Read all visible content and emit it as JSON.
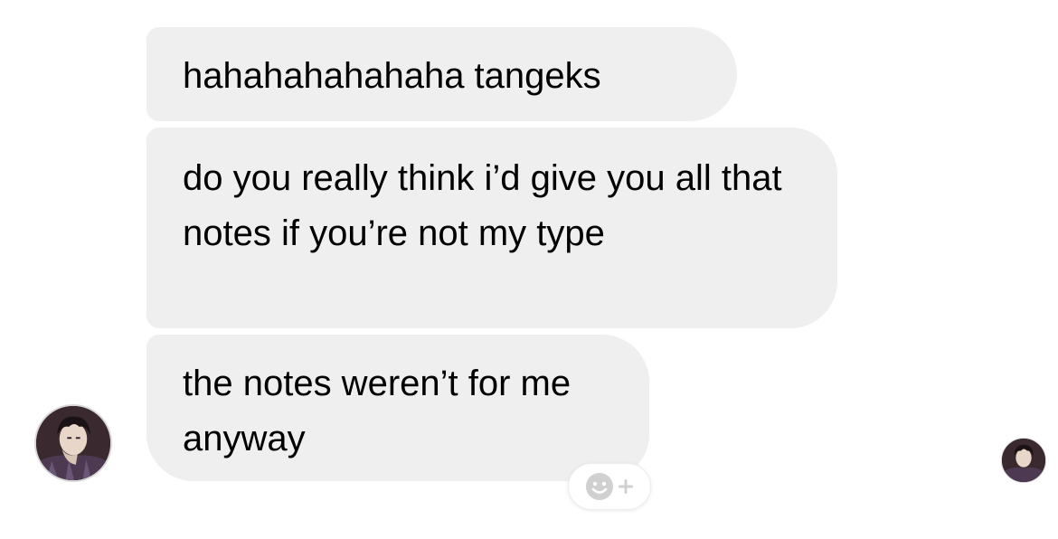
{
  "messages": [
    {
      "text": "hahahahahahaha tangeks"
    },
    {
      "text": "do you really think i’d give you all that notes if you’re not my type"
    },
    {
      "text": "the notes weren’t for me anyway"
    }
  ],
  "avatars": {
    "sender": {
      "icon": "profile-avatar"
    },
    "read_receipt": {
      "icon": "read-receipt-avatar"
    }
  },
  "reaction": {
    "icon": "add-reaction-icon"
  },
  "colors": {
    "bubble": "#efefef",
    "background": "#ffffff",
    "text": "#000000",
    "reaction_icon": "#d0d0d0"
  }
}
